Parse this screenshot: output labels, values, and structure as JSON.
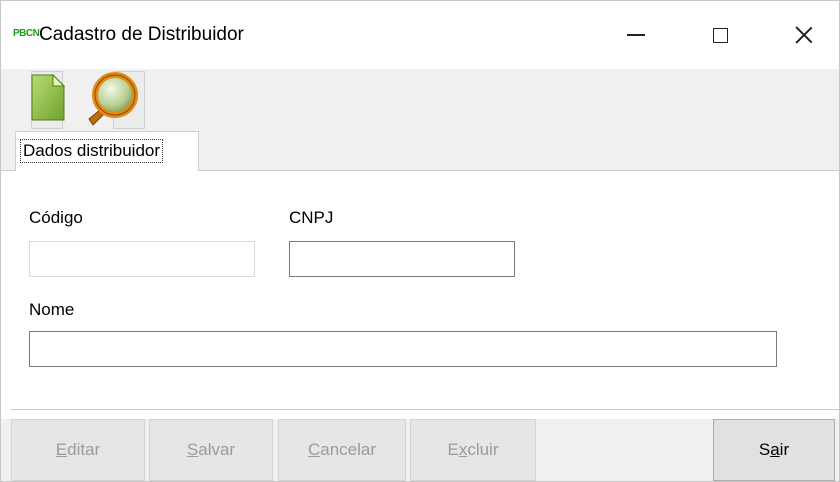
{
  "window": {
    "app_icon_text": "PBCN",
    "title": "Cadastro de Distribuidor",
    "controls": {
      "minimize": "minimize",
      "maximize": "maximize",
      "close": "close"
    }
  },
  "toolbar": {
    "items": [
      {
        "name": "new-document",
        "icon": "document-icon"
      },
      {
        "name": "search",
        "icon": "magnifier-icon"
      }
    ]
  },
  "tabs": [
    {
      "label": "Dados distribuidor",
      "active": true
    }
  ],
  "form": {
    "codigo": {
      "label": "Código",
      "value": "",
      "enabled": false
    },
    "cnpj": {
      "label": "CNPJ",
      "value": "",
      "enabled": true
    },
    "nome": {
      "label": "Nome",
      "value": "",
      "enabled": true
    }
  },
  "buttons": {
    "editar": {
      "mnemonic": "E",
      "rest": "ditar",
      "enabled": false
    },
    "salvar": {
      "mnemonic": "S",
      "rest": "alvar",
      "enabled": false
    },
    "cancelar": {
      "mnemonic": "C",
      "rest": "ancelar",
      "enabled": false
    },
    "excluir": {
      "pre": "E",
      "mnemonic": "x",
      "rest": "cluir",
      "enabled": false
    },
    "sair": {
      "pre": "S",
      "mnemonic": "a",
      "rest": "ir",
      "enabled": true
    }
  },
  "colors": {
    "app_icon": "#1f9a1f",
    "toolbar_bg": "#f0f0f0",
    "disabled_text": "#9b9b9b"
  }
}
